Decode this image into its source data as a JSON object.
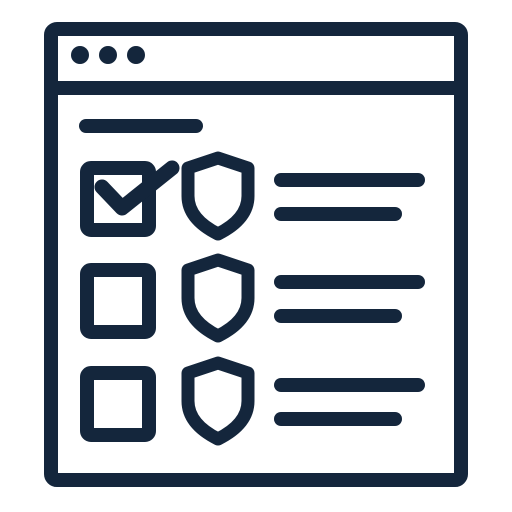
{
  "icon": {
    "name": "security-checklist-window-icon",
    "stroke_color": "#14263c",
    "background_color": "#ffffff"
  },
  "window": {
    "title_bar_dots": 3
  },
  "checklist": {
    "items": [
      {
        "checked": true,
        "icon": "shield-icon"
      },
      {
        "checked": false,
        "icon": "shield-icon"
      },
      {
        "checked": false,
        "icon": "shield-icon"
      }
    ]
  }
}
